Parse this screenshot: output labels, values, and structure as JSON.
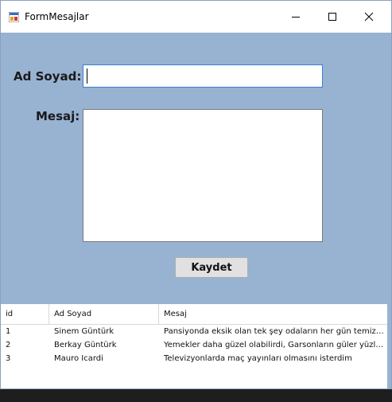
{
  "window": {
    "title": "FormMesajlar",
    "icon": "winforms-app-icon"
  },
  "form": {
    "name_label": "Ad Soyad:",
    "name_value": "",
    "message_label": "Mesaj:",
    "message_value": "",
    "save_label": "Kaydet"
  },
  "grid": {
    "columns": [
      "id",
      "Ad Soyad",
      "Mesaj"
    ],
    "rows": [
      {
        "id": "1",
        "name": "Sinem Güntürk",
        "message": "Pansiyonda eksik olan tek şey odaların her gün temizlen…"
      },
      {
        "id": "2",
        "name": "Berkay Güntürk",
        "message": "Yemekler daha güzel olabilirdi, Garsonların güler yüzlülüğ…"
      },
      {
        "id": "3",
        "name": "Mauro Icardi",
        "message": "Televizyonlarda maç yayınları olmasını isterdim"
      }
    ]
  },
  "colors": {
    "form_background": "#98b2d2",
    "title_bar": "#ffffff",
    "focus_border": "#3c7fd1"
  }
}
